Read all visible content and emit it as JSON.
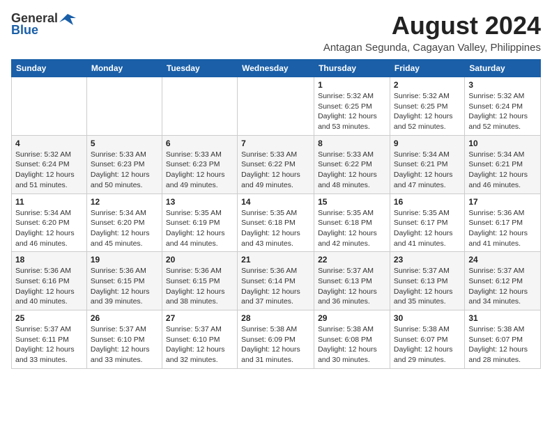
{
  "logo": {
    "general": "General",
    "blue": "Blue"
  },
  "title": {
    "month_year": "August 2024",
    "location": "Antagan Segunda, Cagayan Valley, Philippines"
  },
  "weekdays": [
    "Sunday",
    "Monday",
    "Tuesday",
    "Wednesday",
    "Thursday",
    "Friday",
    "Saturday"
  ],
  "weeks": [
    [
      {
        "day": "",
        "info": ""
      },
      {
        "day": "",
        "info": ""
      },
      {
        "day": "",
        "info": ""
      },
      {
        "day": "",
        "info": ""
      },
      {
        "day": "1",
        "info": "Sunrise: 5:32 AM\nSunset: 6:25 PM\nDaylight: 12 hours\nand 53 minutes."
      },
      {
        "day": "2",
        "info": "Sunrise: 5:32 AM\nSunset: 6:25 PM\nDaylight: 12 hours\nand 52 minutes."
      },
      {
        "day": "3",
        "info": "Sunrise: 5:32 AM\nSunset: 6:24 PM\nDaylight: 12 hours\nand 52 minutes."
      }
    ],
    [
      {
        "day": "4",
        "info": "Sunrise: 5:32 AM\nSunset: 6:24 PM\nDaylight: 12 hours\nand 51 minutes."
      },
      {
        "day": "5",
        "info": "Sunrise: 5:33 AM\nSunset: 6:23 PM\nDaylight: 12 hours\nand 50 minutes."
      },
      {
        "day": "6",
        "info": "Sunrise: 5:33 AM\nSunset: 6:23 PM\nDaylight: 12 hours\nand 49 minutes."
      },
      {
        "day": "7",
        "info": "Sunrise: 5:33 AM\nSunset: 6:22 PM\nDaylight: 12 hours\nand 49 minutes."
      },
      {
        "day": "8",
        "info": "Sunrise: 5:33 AM\nSunset: 6:22 PM\nDaylight: 12 hours\nand 48 minutes."
      },
      {
        "day": "9",
        "info": "Sunrise: 5:34 AM\nSunset: 6:21 PM\nDaylight: 12 hours\nand 47 minutes."
      },
      {
        "day": "10",
        "info": "Sunrise: 5:34 AM\nSunset: 6:21 PM\nDaylight: 12 hours\nand 46 minutes."
      }
    ],
    [
      {
        "day": "11",
        "info": "Sunrise: 5:34 AM\nSunset: 6:20 PM\nDaylight: 12 hours\nand 46 minutes."
      },
      {
        "day": "12",
        "info": "Sunrise: 5:34 AM\nSunset: 6:20 PM\nDaylight: 12 hours\nand 45 minutes."
      },
      {
        "day": "13",
        "info": "Sunrise: 5:35 AM\nSunset: 6:19 PM\nDaylight: 12 hours\nand 44 minutes."
      },
      {
        "day": "14",
        "info": "Sunrise: 5:35 AM\nSunset: 6:18 PM\nDaylight: 12 hours\nand 43 minutes."
      },
      {
        "day": "15",
        "info": "Sunrise: 5:35 AM\nSunset: 6:18 PM\nDaylight: 12 hours\nand 42 minutes."
      },
      {
        "day": "16",
        "info": "Sunrise: 5:35 AM\nSunset: 6:17 PM\nDaylight: 12 hours\nand 41 minutes."
      },
      {
        "day": "17",
        "info": "Sunrise: 5:36 AM\nSunset: 6:17 PM\nDaylight: 12 hours\nand 41 minutes."
      }
    ],
    [
      {
        "day": "18",
        "info": "Sunrise: 5:36 AM\nSunset: 6:16 PM\nDaylight: 12 hours\nand 40 minutes."
      },
      {
        "day": "19",
        "info": "Sunrise: 5:36 AM\nSunset: 6:15 PM\nDaylight: 12 hours\nand 39 minutes."
      },
      {
        "day": "20",
        "info": "Sunrise: 5:36 AM\nSunset: 6:15 PM\nDaylight: 12 hours\nand 38 minutes."
      },
      {
        "day": "21",
        "info": "Sunrise: 5:36 AM\nSunset: 6:14 PM\nDaylight: 12 hours\nand 37 minutes."
      },
      {
        "day": "22",
        "info": "Sunrise: 5:37 AM\nSunset: 6:13 PM\nDaylight: 12 hours\nand 36 minutes."
      },
      {
        "day": "23",
        "info": "Sunrise: 5:37 AM\nSunset: 6:13 PM\nDaylight: 12 hours\nand 35 minutes."
      },
      {
        "day": "24",
        "info": "Sunrise: 5:37 AM\nSunset: 6:12 PM\nDaylight: 12 hours\nand 34 minutes."
      }
    ],
    [
      {
        "day": "25",
        "info": "Sunrise: 5:37 AM\nSunset: 6:11 PM\nDaylight: 12 hours\nand 33 minutes."
      },
      {
        "day": "26",
        "info": "Sunrise: 5:37 AM\nSunset: 6:10 PM\nDaylight: 12 hours\nand 33 minutes."
      },
      {
        "day": "27",
        "info": "Sunrise: 5:37 AM\nSunset: 6:10 PM\nDaylight: 12 hours\nand 32 minutes."
      },
      {
        "day": "28",
        "info": "Sunrise: 5:38 AM\nSunset: 6:09 PM\nDaylight: 12 hours\nand 31 minutes."
      },
      {
        "day": "29",
        "info": "Sunrise: 5:38 AM\nSunset: 6:08 PM\nDaylight: 12 hours\nand 30 minutes."
      },
      {
        "day": "30",
        "info": "Sunrise: 5:38 AM\nSunset: 6:07 PM\nDaylight: 12 hours\nand 29 minutes."
      },
      {
        "day": "31",
        "info": "Sunrise: 5:38 AM\nSunset: 6:07 PM\nDaylight: 12 hours\nand 28 minutes."
      }
    ]
  ]
}
